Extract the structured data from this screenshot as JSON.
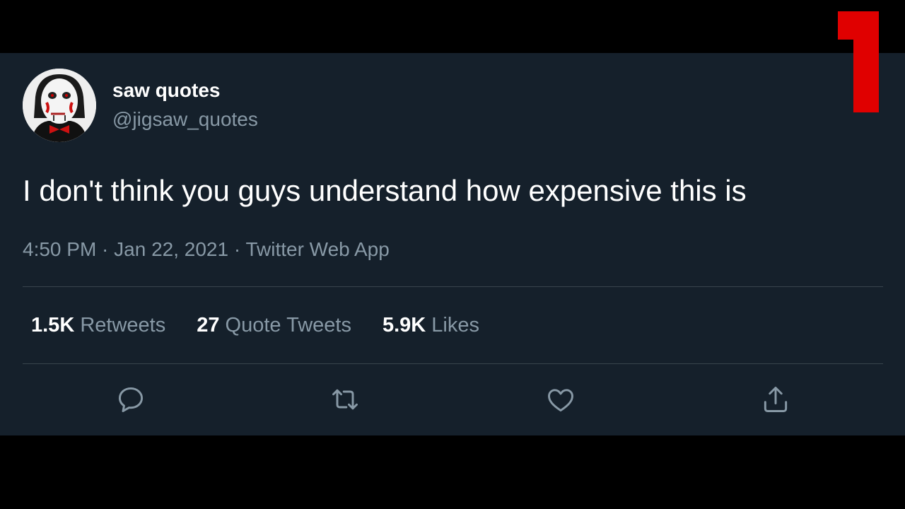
{
  "tweet": {
    "display_name": "saw quotes",
    "handle": "@jigsaw_quotes",
    "text": "I don't think you guys understand how expensive this is",
    "timestamp": "4:50 PM · Jan 22, 2021 · Twitter Web App"
  },
  "stats": {
    "retweets_count": "1.5K",
    "retweets_label": " Retweets",
    "quotes_count": "27",
    "quotes_label": " Quote Tweets",
    "likes_count": "5.9K",
    "likes_label": " Likes"
  },
  "actions": [
    "reply-icon",
    "retweet-icon",
    "like-icon",
    "share-icon"
  ],
  "colors": {
    "background": "#000000",
    "card": "#15202b",
    "text": "#ffffff",
    "secondary": "#8899a6",
    "divider": "#38444d",
    "overlay_number": "#e00000"
  }
}
